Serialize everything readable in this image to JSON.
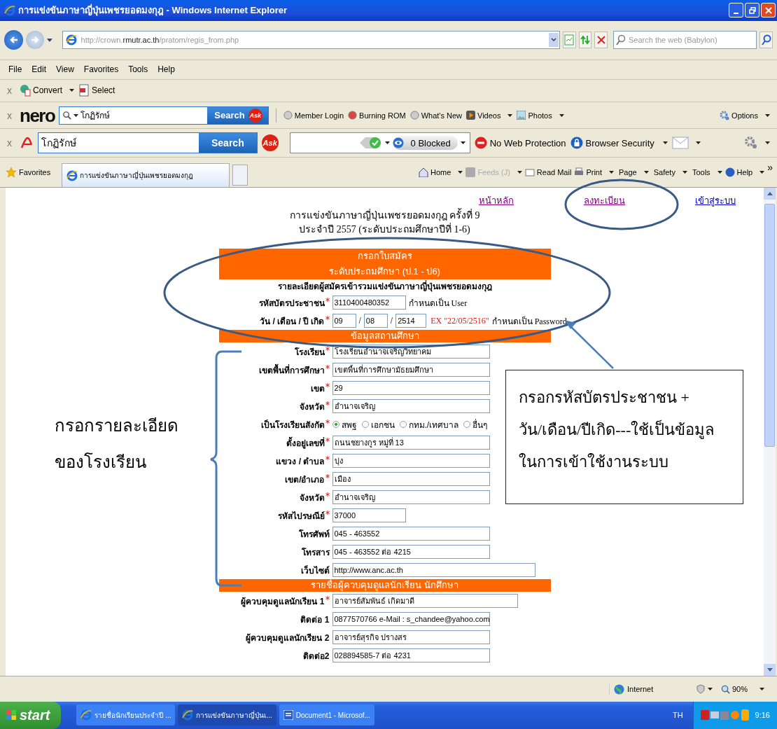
{
  "window": {
    "title": "การแข่งขันภาษาญี่ปุ่นเพชรยอดมงกุฎ - Windows Internet Explorer"
  },
  "address_bar": {
    "url_prefix": "http://crown.",
    "url_host": "rmutr.ac.th",
    "url_path": "/pratom/regis_from.php",
    "search_placeholder": "Search the web (Babylon)"
  },
  "menu": [
    "File",
    "Edit",
    "View",
    "Favorites",
    "Tools",
    "Help"
  ],
  "convert_toolbar": {
    "close": "x",
    "items": [
      {
        "label": "Convert",
        "dropdown": true
      },
      {
        "label": "Select",
        "dropdown": false
      }
    ]
  },
  "nero_toolbar": {
    "close": "x",
    "logo": "nero",
    "search_value": "โกฏิรักษ์",
    "search_button": "Search",
    "ask_logo": "Ask",
    "links": [
      {
        "label": "Member Login",
        "dropdown": false
      },
      {
        "label": "Burning ROM",
        "dropdown": false
      },
      {
        "label": "What's New",
        "dropdown": false
      },
      {
        "label": "Videos",
        "dropdown": true
      },
      {
        "label": "Photos",
        "dropdown": true
      }
    ],
    "options": "Options"
  },
  "avira_toolbar": {
    "close": "x",
    "search_value": "โกฏิรักษ์",
    "search_button": "Search",
    "ask_logo": "Ask",
    "blocked": "0 Blocked",
    "protection": "No Web Protection",
    "security": "Browser Security"
  },
  "favorites_bar": {
    "favorites": "Favorites",
    "tabs": [
      {
        "title": "การแข่งขันภาษาญี่ปุ่นเพชรยอดมงกุฎ",
        "selected": true
      }
    ]
  },
  "command_bar": {
    "items": [
      {
        "label": "Home",
        "dropdown": true,
        "disabled": false
      },
      {
        "label": "Feeds (J)",
        "dropdown": true,
        "disabled": true
      },
      {
        "label": "Read Mail",
        "dropdown": false,
        "disabled": false
      },
      {
        "label": "Print",
        "dropdown": true,
        "disabled": false
      },
      {
        "label": "Page",
        "dropdown": true,
        "disabled": false
      },
      {
        "label": "Safety",
        "dropdown": true,
        "disabled": false
      },
      {
        "label": "Tools",
        "dropdown": true,
        "disabled": false
      },
      {
        "label": "Help",
        "dropdown": true,
        "disabled": false
      }
    ],
    "more": "»"
  },
  "page": {
    "nav": [
      {
        "label": "หน้าหลัก",
        "visited": true
      },
      {
        "label": "ลงทะเบียน",
        "visited": true
      },
      {
        "label": "เข้าสู่ระบบ",
        "visited": false
      }
    ],
    "heading": [
      "การแข่งขันภาษาญี่ปุ่นเพชรยอดมงกุฎ ครั้งที่ 9",
      "ประจำปี 2557 (ระดับประถมศึกษาปีที่ 1-6)"
    ],
    "sections": [
      {
        "header": [
          "กรอกใบสมัคร",
          "ระดับประถมศึกษา (ป.1 - ป6)"
        ],
        "subtitle": "รายละเอียดผู้สมัครเข้ารวมแข่งขันภาษาญี่ปุ่นเพชรยอดมงกุฎ",
        "rows": [
          {
            "kind": "short",
            "label": "รหัสบัตรประชาชน",
            "required": true,
            "value": "3110400480352",
            "note": "กำหนดเป็น User"
          },
          {
            "kind": "date",
            "label": "วัน / เดือน / ปี เกิด",
            "required": true,
            "parts": [
              "09",
              "08",
              "2514"
            ],
            "separators": [
              "/",
              "/"
            ],
            "example": "EX \"22/05/2516\"",
            "note": "กำหนดเป็น Password"
          }
        ]
      },
      {
        "header": [
          "ข้อมูลสถานศึกษา"
        ],
        "rows": [
          {
            "kind": "text",
            "label": "โรงเรียน",
            "required": true,
            "value": "โรงเรียนอำนาจเจริญวิทยาคม"
          },
          {
            "kind": "text",
            "label": "เขตพื้นที่การศึกษา",
            "required": true,
            "value": "เขตพื้นที่การศึกษามัธยมศึกษา"
          },
          {
            "kind": "text",
            "label": "เขต",
            "required": true,
            "value": "29"
          },
          {
            "kind": "text",
            "label": "จังหวัด",
            "required": true,
            "value": "อำนาจเจริญ"
          },
          {
            "kind": "radio",
            "label": "เป็นโรงเรียนสังกัด",
            "required": true,
            "options": [
              {
                "label": "สพฐ",
                "selected": true
              },
              {
                "label": "เอกชน",
                "selected": false
              },
              {
                "label": "กทม./เทศบาล",
                "selected": false
              },
              {
                "label": "อื่นๆ",
                "selected": false
              }
            ]
          },
          {
            "kind": "text",
            "label": "ตั้งอยู่เลขที่",
            "required": true,
            "value": "ถนนชยางกูร หมู่ที่ 13"
          },
          {
            "kind": "text",
            "label": "แขวง / ตำบล",
            "required": true,
            "value": "บุ่ง"
          },
          {
            "kind": "text",
            "label": "เขต/อำเภอ",
            "required": true,
            "value": "เมือง"
          },
          {
            "kind": "text",
            "label": "จังหวัด",
            "required": true,
            "value": "อำนาจเจริญ"
          },
          {
            "kind": "short",
            "label": "รหัสไปรษณีย์",
            "required": true,
            "value": "37000"
          },
          {
            "kind": "text",
            "label": "โทรศัพท์",
            "required": false,
            "value": "045 - 463552"
          },
          {
            "kind": "text",
            "label": "โทรสาร",
            "required": false,
            "value": "045 - 463552  ต่อ 4215"
          },
          {
            "kind": "long",
            "label": "เว็บไซต์",
            "required": false,
            "value": "http://www.anc.ac.th"
          }
        ]
      },
      {
        "header": [
          "รายชื่อผู้ควบคุมดูแลนักเรียน นักศึกษา"
        ],
        "rows": [
          {
            "kind": "medium",
            "label": "ผู้ควบคุมดูแลนักเรียน 1",
            "required": true,
            "value": "อาจารย์สัมพันธ์ เกิดมาดี"
          },
          {
            "kind": "text",
            "label": "ติดต่อ 1",
            "required": false,
            "value": "0877570766  e-Mail : s_chandee@yahoo.com"
          },
          {
            "kind": "text",
            "label": "ผู้ควบคุมดูแลนักเรียน 2",
            "required": false,
            "value": "อาจารย์สุรกิจ ปรางสร"
          },
          {
            "kind": "text",
            "label": "ติดต่อ2",
            "required": false,
            "value": "028894585-7 ต่อ 4231"
          }
        ]
      }
    ]
  },
  "annotations": {
    "left_note": [
      "กรอกรายละเอียด",
      "ของโรงเรียน"
    ],
    "callout": [
      "กรอกรหัสบัตรประชาชน  +",
      "วัน/เดือน/ปีเกิด---ใช้เป็นข้อมูล",
      "ในการเข้าใช้งานระบบ"
    ]
  },
  "status_bar": {
    "zone": "Internet",
    "zoom": "90%"
  },
  "taskbar": {
    "start": "start",
    "tasks": [
      {
        "label": "รายชื่อนักเรียนประจำปี ...",
        "kind": "browser",
        "selected": false
      },
      {
        "label": "การแข่งขันภาษาญี่ปุ่นเ...",
        "kind": "browser",
        "selected": true
      },
      {
        "label": "Document1 - Microsof...",
        "kind": "document",
        "selected": false
      }
    ],
    "language": "TH",
    "time": "9:16"
  }
}
